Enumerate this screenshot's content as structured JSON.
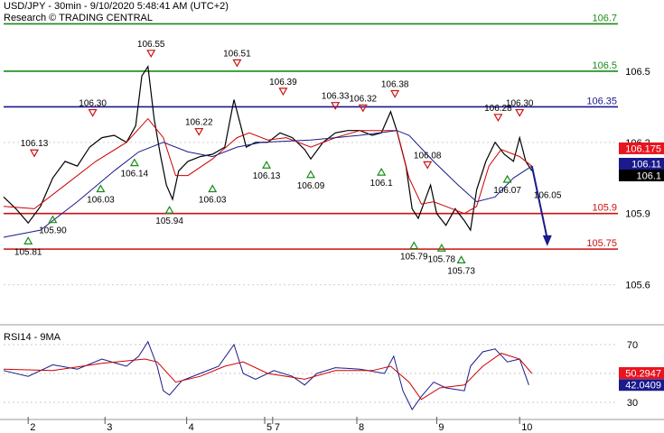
{
  "header": {
    "title": "USD/JPY - 30min - 9/10/2020 5:48:41 AM (UTC+2)",
    "subtitle": "Research © TRADING CENTRAL"
  },
  "chart_data": [
    {
      "type": "line",
      "name": "price",
      "ylim": [
        105.45,
        106.77
      ],
      "y_ticks": [
        "106.5",
        "106.2",
        "105.9",
        "105.6"
      ],
      "x_ticks": [
        {
          "label": "2",
          "t": 0.04
        },
        {
          "label": "3",
          "t": 0.165
        },
        {
          "label": "4",
          "t": 0.298
        },
        {
          "label": "5",
          "t": 0.425
        },
        {
          "label": "7",
          "t": 0.438
        },
        {
          "label": "8",
          "t": 0.575
        },
        {
          "label": "9",
          "t": 0.705
        },
        {
          "label": "10",
          "t": 0.84
        }
      ],
      "levels": [
        {
          "value": 106.7,
          "label": "106.7",
          "color": "#1a8a1a"
        },
        {
          "value": 106.5,
          "label": "106.5",
          "color": "#1a8a1a"
        },
        {
          "value": 106.35,
          "label": "106.35",
          "color": "#1a1a8c"
        },
        {
          "value": 105.9,
          "label": "105.9",
          "color": "#cc1111"
        },
        {
          "value": 105.75,
          "label": "105.75",
          "color": "#cc1111"
        }
      ],
      "price_badges": [
        {
          "value": 106.175,
          "label": "106.175",
          "bg": "#e8141e",
          "fg": "#ffffff"
        },
        {
          "value": 106.11,
          "label": "106.11",
          "bg": "#1a1a8c",
          "fg": "#ffffff"
        },
        {
          "value": 106.1,
          "label": "106.1",
          "bg": "#000000",
          "fg": "#ffffff"
        }
      ],
      "series": [
        {
          "name": "Close",
          "color": "#000000",
          "points": [
            [
              0.0,
              105.97
            ],
            [
              0.02,
              105.92
            ],
            [
              0.04,
              105.86
            ],
            [
              0.06,
              105.93
            ],
            [
              0.08,
              106.05
            ],
            [
              0.1,
              106.12
            ],
            [
              0.12,
              106.1
            ],
            [
              0.14,
              106.18
            ],
            [
              0.16,
              106.22
            ],
            [
              0.18,
              106.23
            ],
            [
              0.2,
              106.2
            ],
            [
              0.215,
              106.27
            ],
            [
              0.225,
              106.48
            ],
            [
              0.235,
              106.52
            ],
            [
              0.245,
              106.3
            ],
            [
              0.255,
              106.15
            ],
            [
              0.265,
              106.02
            ],
            [
              0.275,
              105.96
            ],
            [
              0.285,
              106.08
            ],
            [
              0.3,
              106.12
            ],
            [
              0.32,
              106.14
            ],
            [
              0.34,
              106.15
            ],
            [
              0.36,
              106.18
            ],
            [
              0.375,
              106.38
            ],
            [
              0.385,
              106.28
            ],
            [
              0.395,
              106.18
            ],
            [
              0.41,
              106.2
            ],
            [
              0.43,
              106.2
            ],
            [
              0.45,
              106.24
            ],
            [
              0.47,
              106.22
            ],
            [
              0.49,
              106.17
            ],
            [
              0.5,
              106.13
            ],
            [
              0.52,
              106.2
            ],
            [
              0.54,
              106.24
            ],
            [
              0.56,
              106.25
            ],
            [
              0.58,
              106.25
            ],
            [
              0.6,
              106.23
            ],
            [
              0.615,
              106.24
            ],
            [
              0.63,
              106.33
            ],
            [
              0.64,
              106.25
            ],
            [
              0.655,
              106.1
            ],
            [
              0.665,
              105.92
            ],
            [
              0.675,
              105.88
            ],
            [
              0.685,
              105.95
            ],
            [
              0.695,
              106.02
            ],
            [
              0.705,
              105.9
            ],
            [
              0.72,
              105.85
            ],
            [
              0.735,
              105.92
            ],
            [
              0.75,
              105.87
            ],
            [
              0.76,
              105.83
            ],
            [
              0.77,
              106.0
            ],
            [
              0.785,
              106.12
            ],
            [
              0.8,
              106.2
            ],
            [
              0.815,
              106.15
            ],
            [
              0.83,
              106.12
            ],
            [
              0.84,
              106.22
            ],
            [
              0.85,
              106.12
            ],
            [
              0.86,
              106.08
            ]
          ]
        },
        {
          "name": "MA-red",
          "color": "#cc0000",
          "points": [
            [
              0.0,
              105.93
            ],
            [
              0.05,
              105.92
            ],
            [
              0.1,
              106.02
            ],
            [
              0.15,
              106.12
            ],
            [
              0.2,
              106.2
            ],
            [
              0.235,
              106.3
            ],
            [
              0.26,
              106.22
            ],
            [
              0.28,
              106.06
            ],
            [
              0.3,
              106.06
            ],
            [
              0.34,
              106.13
            ],
            [
              0.38,
              106.22
            ],
            [
              0.4,
              106.24
            ],
            [
              0.43,
              106.21
            ],
            [
              0.46,
              106.22
            ],
            [
              0.5,
              106.18
            ],
            [
              0.54,
              106.22
            ],
            [
              0.58,
              106.25
            ],
            [
              0.62,
              106.25
            ],
            [
              0.64,
              106.25
            ],
            [
              0.66,
              106.05
            ],
            [
              0.68,
              105.94
            ],
            [
              0.7,
              105.95
            ],
            [
              0.72,
              105.93
            ],
            [
              0.75,
              105.9
            ],
            [
              0.77,
              105.93
            ],
            [
              0.79,
              106.1
            ],
            [
              0.81,
              106.17
            ],
            [
              0.84,
              106.14
            ],
            [
              0.86,
              106.1
            ]
          ]
        },
        {
          "name": "MA-blue",
          "color": "#1a1a8c",
          "points": [
            [
              0.0,
              105.8
            ],
            [
              0.06,
              105.83
            ],
            [
              0.12,
              105.95
            ],
            [
              0.18,
              106.08
            ],
            [
              0.22,
              106.16
            ],
            [
              0.26,
              106.2
            ],
            [
              0.3,
              106.16
            ],
            [
              0.34,
              106.14
            ],
            [
              0.38,
              106.18
            ],
            [
              0.42,
              106.2
            ],
            [
              0.5,
              106.21
            ],
            [
              0.58,
              106.23
            ],
            [
              0.64,
              106.25
            ],
            [
              0.66,
              106.23
            ],
            [
              0.7,
              106.12
            ],
            [
              0.74,
              106.02
            ],
            [
              0.77,
              105.95
            ],
            [
              0.8,
              105.97
            ],
            [
              0.83,
              106.05
            ],
            [
              0.86,
              106.1
            ]
          ]
        }
      ],
      "projection": {
        "from": [
          0.86,
          106.1
        ],
        "to": [
          0.885,
          105.77
        ],
        "color": "#1a1a8c"
      },
      "annotations": [
        {
          "label": "106.13",
          "x": 0.05,
          "y": 106.13,
          "kind": "high"
        },
        {
          "label": "106.30",
          "x": 0.145,
          "y": 106.3,
          "kind": "high"
        },
        {
          "label": "106.55",
          "x": 0.24,
          "y": 106.55,
          "kind": "high"
        },
        {
          "label": "106.22",
          "x": 0.318,
          "y": 106.22,
          "kind": "high"
        },
        {
          "label": "106.51",
          "x": 0.38,
          "y": 106.51,
          "kind": "high"
        },
        {
          "label": "106.39",
          "x": 0.455,
          "y": 106.39,
          "kind": "high"
        },
        {
          "label": "106.33",
          "x": 0.54,
          "y": 106.33,
          "kind": "high"
        },
        {
          "label": "106.32",
          "x": 0.585,
          "y": 106.32,
          "kind": "high"
        },
        {
          "label": "106.38",
          "x": 0.637,
          "y": 106.38,
          "kind": "high"
        },
        {
          "label": "106.08",
          "x": 0.69,
          "y": 106.08,
          "kind": "high"
        },
        {
          "label": "106.28",
          "x": 0.805,
          "y": 106.28,
          "kind": "high"
        },
        {
          "label": "106.30",
          "x": 0.84,
          "y": 106.3,
          "kind": "high"
        },
        {
          "label": "105.81",
          "x": 0.04,
          "y": 105.81,
          "kind": "low"
        },
        {
          "label": "105.90",
          "x": 0.08,
          "y": 105.9,
          "kind": "low"
        },
        {
          "label": "106.03",
          "x": 0.158,
          "y": 106.03,
          "kind": "low"
        },
        {
          "label": "106.14",
          "x": 0.213,
          "y": 106.14,
          "kind": "low"
        },
        {
          "label": "105.94",
          "x": 0.27,
          "y": 105.94,
          "kind": "low"
        },
        {
          "label": "106.03",
          "x": 0.34,
          "y": 106.03,
          "kind": "low"
        },
        {
          "label": "106.13",
          "x": 0.428,
          "y": 106.13,
          "kind": "low"
        },
        {
          "label": "106.09",
          "x": 0.5,
          "y": 106.09,
          "kind": "low"
        },
        {
          "label": "106.1",
          "x": 0.615,
          "y": 106.1,
          "kind": "low"
        },
        {
          "label": "105.79",
          "x": 0.668,
          "y": 105.79,
          "kind": "low"
        },
        {
          "label": "105.78",
          "x": 0.713,
          "y": 105.78,
          "kind": "low"
        },
        {
          "label": "105.73",
          "x": 0.745,
          "y": 105.73,
          "kind": "low"
        },
        {
          "label": "106.07",
          "x": 0.82,
          "y": 106.07,
          "kind": "low"
        },
        {
          "label": "106.05",
          "x": 0.86,
          "y": 106.05,
          "kind": "none"
        }
      ]
    },
    {
      "type": "line",
      "name": "RSI14 - 9MA",
      "title": "RSI14 - 9MA",
      "ylim": [
        20,
        80
      ],
      "y_ticks": [
        "70",
        "30"
      ],
      "guides": [
        70,
        50,
        30
      ],
      "badges": [
        {
          "value": 50.2947,
          "label": "50.2947",
          "bg": "#e8141e",
          "fg": "#ffffff"
        },
        {
          "value": 42.0409,
          "label": "42.0409",
          "bg": "#1a1a8c",
          "fg": "#ffffff"
        }
      ],
      "series": [
        {
          "name": "RSI14",
          "color": "#1a1a8c",
          "points": [
            [
              0.0,
              52
            ],
            [
              0.04,
              48
            ],
            [
              0.08,
              56
            ],
            [
              0.12,
              53
            ],
            [
              0.16,
              60
            ],
            [
              0.2,
              55
            ],
            [
              0.22,
              62
            ],
            [
              0.235,
              72
            ],
            [
              0.25,
              55
            ],
            [
              0.26,
              38
            ],
            [
              0.27,
              35
            ],
            [
              0.29,
              45
            ],
            [
              0.32,
              50
            ],
            [
              0.35,
              55
            ],
            [
              0.375,
              70
            ],
            [
              0.39,
              50
            ],
            [
              0.41,
              46
            ],
            [
              0.44,
              52
            ],
            [
              0.47,
              48
            ],
            [
              0.49,
              42
            ],
            [
              0.51,
              50
            ],
            [
              0.54,
              54
            ],
            [
              0.58,
              53
            ],
            [
              0.62,
              50
            ],
            [
              0.635,
              62
            ],
            [
              0.65,
              38
            ],
            [
              0.665,
              25
            ],
            [
              0.68,
              34
            ],
            [
              0.7,
              44
            ],
            [
              0.72,
              40
            ],
            [
              0.75,
              38
            ],
            [
              0.76,
              55
            ],
            [
              0.78,
              65
            ],
            [
              0.8,
              67
            ],
            [
              0.82,
              58
            ],
            [
              0.84,
              60
            ],
            [
              0.855,
              42
            ]
          ]
        },
        {
          "name": "MA9",
          "color": "#cc0000",
          "points": [
            [
              0.0,
              53
            ],
            [
              0.08,
              52
            ],
            [
              0.16,
              57
            ],
            [
              0.23,
              60
            ],
            [
              0.25,
              58
            ],
            [
              0.28,
              44
            ],
            [
              0.32,
              48
            ],
            [
              0.36,
              55
            ],
            [
              0.39,
              58
            ],
            [
              0.43,
              50
            ],
            [
              0.49,
              46
            ],
            [
              0.54,
              52
            ],
            [
              0.6,
              52
            ],
            [
              0.63,
              55
            ],
            [
              0.66,
              44
            ],
            [
              0.68,
              32
            ],
            [
              0.71,
              40
            ],
            [
              0.75,
              42
            ],
            [
              0.78,
              55
            ],
            [
              0.81,
              64
            ],
            [
              0.84,
              60
            ],
            [
              0.86,
              50
            ]
          ]
        }
      ]
    }
  ]
}
